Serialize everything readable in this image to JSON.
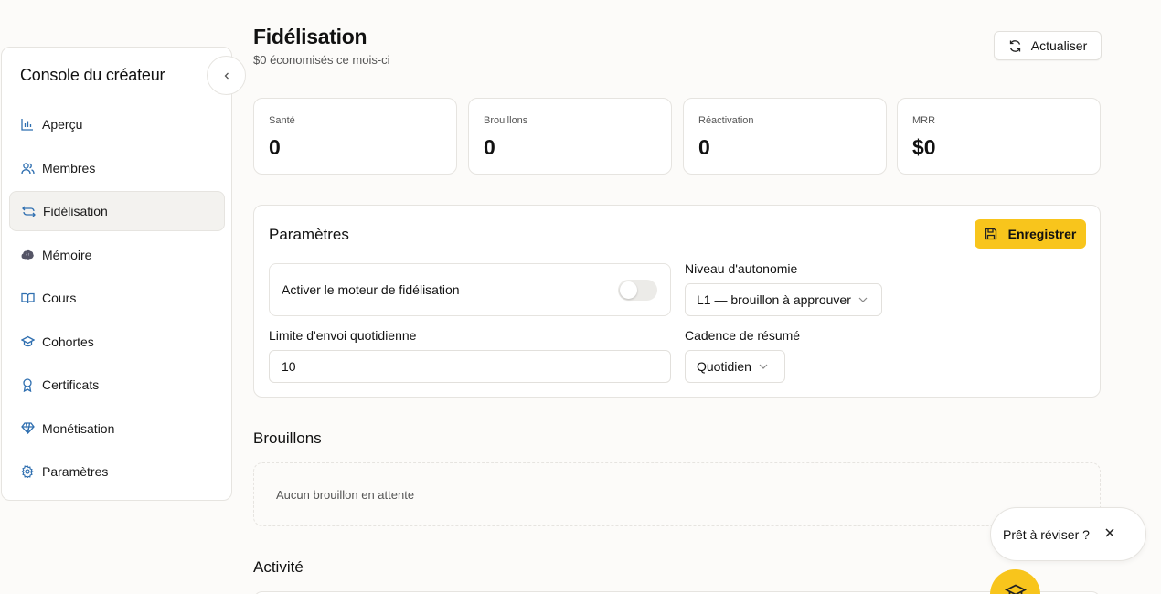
{
  "sidebar": {
    "title": "Console du créateur",
    "items": [
      {
        "label": "Aperçu",
        "icon": "bar-chart-icon"
      },
      {
        "label": "Membres",
        "icon": "users-icon"
      },
      {
        "label": "Fidélisation",
        "icon": "repeat-icon",
        "active": true
      },
      {
        "label": "Mémoire",
        "icon": "brain-icon"
      },
      {
        "label": "Cours",
        "icon": "book-open-icon"
      },
      {
        "label": "Cohortes",
        "icon": "graduation-cap-icon"
      },
      {
        "label": "Certificats",
        "icon": "award-icon"
      },
      {
        "label": "Monétisation",
        "icon": "gem-icon"
      },
      {
        "label": "Paramètres",
        "icon": "gear-icon"
      }
    ]
  },
  "header": {
    "title": "Fidélisation",
    "subtitle": "$0 économisés ce mois-ci",
    "refresh_label": "Actualiser"
  },
  "stats": [
    {
      "label": "Santé",
      "value": "0"
    },
    {
      "label": "Brouillons",
      "value": "0"
    },
    {
      "label": "Réactivation",
      "value": "0"
    },
    {
      "label": "MRR",
      "value": "$0"
    }
  ],
  "settings": {
    "title": "Paramètres",
    "save_label": "Enregistrer",
    "engine_toggle_label": "Activer le moteur de fidélisation",
    "engine_enabled": false,
    "autonomy_label": "Niveau d'autonomie",
    "autonomy_value": "L1 — brouillon à approuver",
    "daily_limit_label": "Limite d'envoi quotidienne",
    "daily_limit_value": "10",
    "cadence_label": "Cadence de résumé",
    "cadence_value": "Quotidien"
  },
  "drafts": {
    "title": "Brouillons",
    "empty_text": "Aucun brouillon en attente"
  },
  "activity": {
    "title": "Activité"
  },
  "help": {
    "toast_text": "Prêt à réviser ?"
  },
  "colors": {
    "accent": "#f8c51c",
    "icon_blue": "#2f6fb0",
    "background": "#fcfbf9"
  }
}
